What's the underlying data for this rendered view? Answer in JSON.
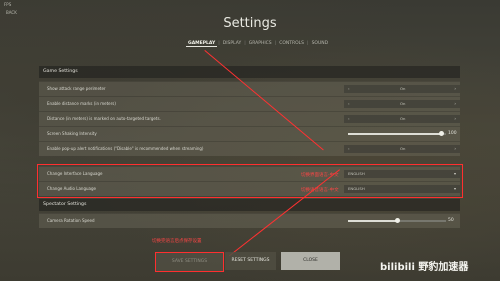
{
  "topbar": {
    "fps": "FPS",
    "back": "BACK"
  },
  "title": "Settings",
  "tabs": [
    "GAMEPLAY",
    "DISPLAY",
    "GRAPHICS",
    "CONTROLS",
    "SOUND"
  ],
  "sections": {
    "game": "Game Settings",
    "spectator": "Spectator Settings"
  },
  "rows": [
    {
      "label": "Show attack range perimeter",
      "value": "On"
    },
    {
      "label": "Enable distance marks (in meters)",
      "value": "On"
    },
    {
      "label": "Distance (in meters) is marked on auto-targeted targets.",
      "value": "On"
    },
    {
      "label": "Screen Shaking Intensity",
      "value": "100",
      "level": 0.95
    },
    {
      "label": "Enable pop-up alert notifications (\"Disable\" is recommended when streaming)",
      "value": "On"
    },
    {
      "label": "Change Interface Language",
      "value": "ENGLISH",
      "annotation": "切换界面语言-中文"
    },
    {
      "label": "Change Audio Language",
      "value": "ENGLISH",
      "annotation": "切换语音语言-中文"
    }
  ],
  "camera": {
    "label": "Camera Rotation Speed",
    "value": "50",
    "level": 0.5
  },
  "buttons": {
    "save": "SAVE SETTINGS",
    "reset": "RESET SETTINGS",
    "close": "CLOSE"
  },
  "annotations": {
    "save_hint": "切换完语言后点保存设置"
  },
  "watermark": "bilibili 野豹加速器",
  "colors": {
    "annotation": "#ff3131",
    "accent": "#e6e6de"
  }
}
